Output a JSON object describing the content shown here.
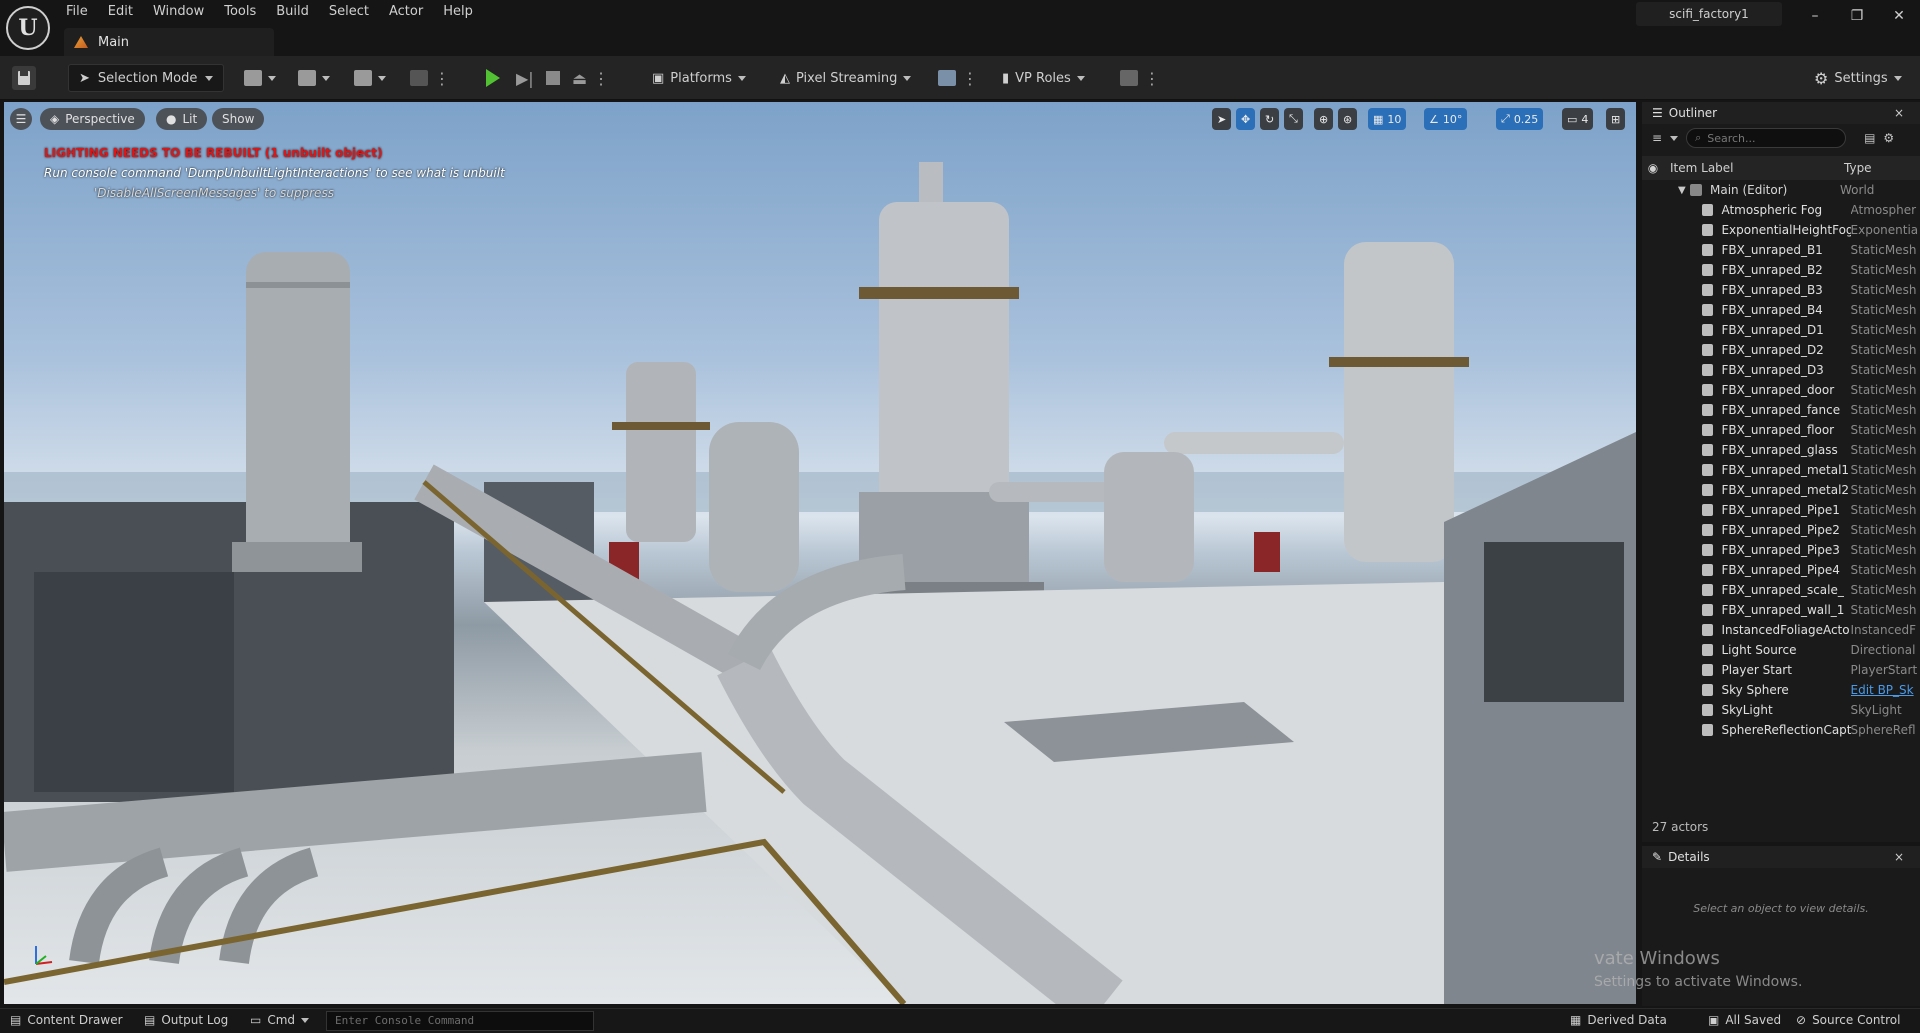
{
  "app": {
    "logo": "U",
    "project": "scifi_factory1",
    "tab": "Main",
    "menu": [
      "File",
      "Edit",
      "Window",
      "Tools",
      "Build",
      "Select",
      "Actor",
      "Help"
    ],
    "window_controls": [
      "–",
      "❐",
      "✕"
    ]
  },
  "toolbar": {
    "selection_mode": "Selection Mode",
    "platforms": "Platforms",
    "pixel_streaming": "Pixel Streaming",
    "vp_roles": "VP Roles",
    "settings": "Settings"
  },
  "viewport": {
    "perspective": "Perspective",
    "lit": "Lit",
    "show": "Show",
    "grid_snap": "10",
    "angle_snap": "10°",
    "scale_snap": "0.25",
    "camera_speed": "4",
    "warning": "LIGHTING NEEDS TO BE REBUILT (1 unbuilt object)",
    "hint": "Run console command 'DumpUnbuiltLightInteractions' to see what is unbuilt",
    "suppress": "'DisableAllScreenMessages' to suppress"
  },
  "outliner": {
    "title": "Outliner",
    "search_placeholder": "Search...",
    "col_label": "Item Label",
    "col_type": "Type",
    "root": {
      "label": "Main (Editor)",
      "type": "World"
    },
    "items": [
      {
        "label": "Atmospheric Fog",
        "type": "Atmospher"
      },
      {
        "label": "ExponentialHeightFog",
        "type": "Exponentia"
      },
      {
        "label": "FBX_unraped_B1",
        "type": "StaticMesh"
      },
      {
        "label": "FBX_unraped_B2",
        "type": "StaticMesh"
      },
      {
        "label": "FBX_unraped_B3",
        "type": "StaticMesh"
      },
      {
        "label": "FBX_unraped_B4",
        "type": "StaticMesh"
      },
      {
        "label": "FBX_unraped_D1",
        "type": "StaticMesh"
      },
      {
        "label": "FBX_unraped_D2",
        "type": "StaticMesh"
      },
      {
        "label": "FBX_unraped_D3",
        "type": "StaticMesh"
      },
      {
        "label": "FBX_unraped_door",
        "type": "StaticMesh"
      },
      {
        "label": "FBX_unraped_fance",
        "type": "StaticMesh"
      },
      {
        "label": "FBX_unraped_floor",
        "type": "StaticMesh"
      },
      {
        "label": "FBX_unraped_glass",
        "type": "StaticMesh"
      },
      {
        "label": "FBX_unraped_metal1",
        "type": "StaticMesh"
      },
      {
        "label": "FBX_unraped_metal2",
        "type": "StaticMesh"
      },
      {
        "label": "FBX_unraped_Pipe1",
        "type": "StaticMesh"
      },
      {
        "label": "FBX_unraped_Pipe2",
        "type": "StaticMesh"
      },
      {
        "label": "FBX_unraped_Pipe3",
        "type": "StaticMesh"
      },
      {
        "label": "FBX_unraped_Pipe4",
        "type": "StaticMesh"
      },
      {
        "label": "FBX_unraped_scale_",
        "type": "StaticMesh"
      },
      {
        "label": "FBX_unraped_wall_1",
        "type": "StaticMesh"
      },
      {
        "label": "InstancedFoliageActo",
        "type": "InstancedF"
      },
      {
        "label": "Light Source",
        "type": "Directional"
      },
      {
        "label": "Player Start",
        "type": "PlayerStart"
      },
      {
        "label": "Sky Sphere",
        "type": "Edit BP_Sk"
      },
      {
        "label": "SkyLight",
        "type": "SkyLight"
      },
      {
        "label": "SphereReflectionCapt",
        "type": "SphereRefl"
      }
    ],
    "count": "27 actors"
  },
  "details": {
    "title": "Details",
    "empty": "Select an object to view details."
  },
  "watermark": {
    "line1": "vate Windows",
    "line2": "Settings to activate Windows."
  },
  "statusbar": {
    "content_drawer": "Content Drawer",
    "output_log": "Output Log",
    "cmd": "Cmd",
    "console_placeholder": "Enter Console Command",
    "derived_data": "Derived Data",
    "all_saved": "All Saved",
    "source_control": "Source Control"
  }
}
